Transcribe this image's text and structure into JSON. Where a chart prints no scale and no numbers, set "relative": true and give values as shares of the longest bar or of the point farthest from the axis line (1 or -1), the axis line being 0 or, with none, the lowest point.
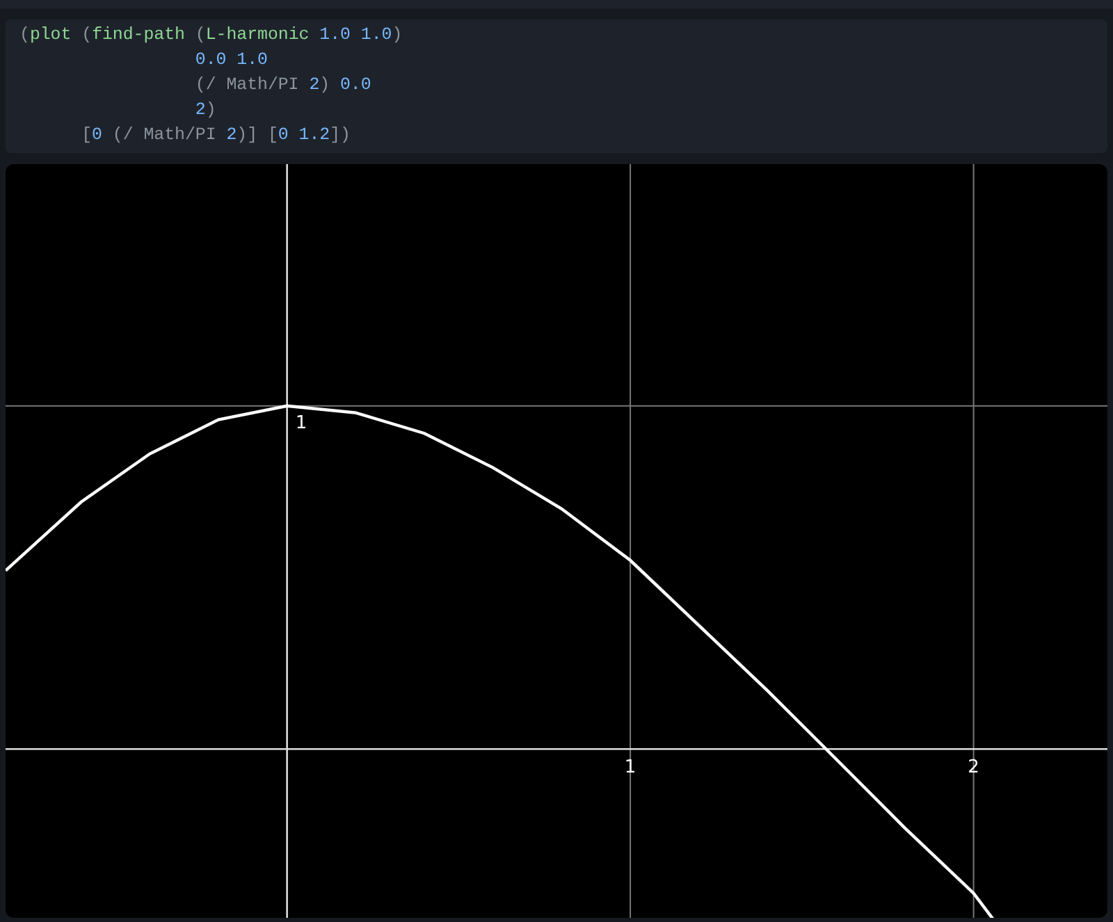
{
  "code": {
    "lines": [
      {
        "kind": "head",
        "tokens": [
          {
            "kind": "punct",
            "text": "("
          },
          {
            "kind": "fn",
            "text": "plot"
          },
          {
            "kind": "punct",
            "text": " ("
          },
          {
            "kind": "fn",
            "text": "find-path"
          },
          {
            "kind": "punct",
            "text": " ("
          },
          {
            "kind": "fn",
            "text": "L-harmonic"
          },
          {
            "kind": "num",
            "text": "1.0 1.0",
            "space_before": true
          },
          {
            "kind": "punct",
            "text": ")"
          }
        ]
      },
      {
        "kind": "arg",
        "tokens": [
          {
            "kind": "num",
            "text": "0.0 1.0"
          }
        ]
      },
      {
        "kind": "arg",
        "tokens": [
          {
            "kind": "punct",
            "text": "(/ Math/PI "
          },
          {
            "kind": "num",
            "text": "2"
          },
          {
            "kind": "punct",
            "text": ") "
          },
          {
            "kind": "num",
            "text": "0.0"
          }
        ]
      },
      {
        "kind": "arg",
        "tokens": [
          {
            "kind": "num",
            "text": "2"
          },
          {
            "kind": "punct",
            "text": ")"
          }
        ]
      },
      {
        "kind": "outer",
        "tokens": [
          {
            "kind": "punct",
            "text": "["
          },
          {
            "kind": "num",
            "text": "0"
          },
          {
            "kind": "punct",
            "text": " (/ Math/PI "
          },
          {
            "kind": "num",
            "text": "2"
          },
          {
            "kind": "punct",
            "text": ")] ["
          },
          {
            "kind": "num",
            "text": "0 1.2"
          },
          {
            "kind": "punct",
            "text": "])"
          }
        ]
      }
    ]
  },
  "plot": {
    "chart_data": {
      "type": "line",
      "relative": true,
      "xlim": [
        -0.82,
        2.39
      ],
      "xticks": [
        1,
        2
      ],
      "x": [
        -0.82,
        -0.6,
        -0.4,
        -0.2,
        0,
        0.2,
        0.4,
        0.6,
        0.8,
        1.0,
        1.2,
        1.4,
        1.6,
        1.8,
        2.0,
        2.06
      ],
      "series": [
        {
          "color": "#ffffff",
          "values": [
            0.52,
            0.72,
            0.86,
            0.96,
            1.0,
            0.98,
            0.92,
            0.82,
            0.7,
            0.55,
            0.36,
            0.17,
            -0.03,
            -0.23,
            -0.42,
            -0.5
          ]
        }
      ],
      "annotations": [
        {
          "text": "1",
          "x": 0,
          "y": 1
        }
      ]
    }
  }
}
